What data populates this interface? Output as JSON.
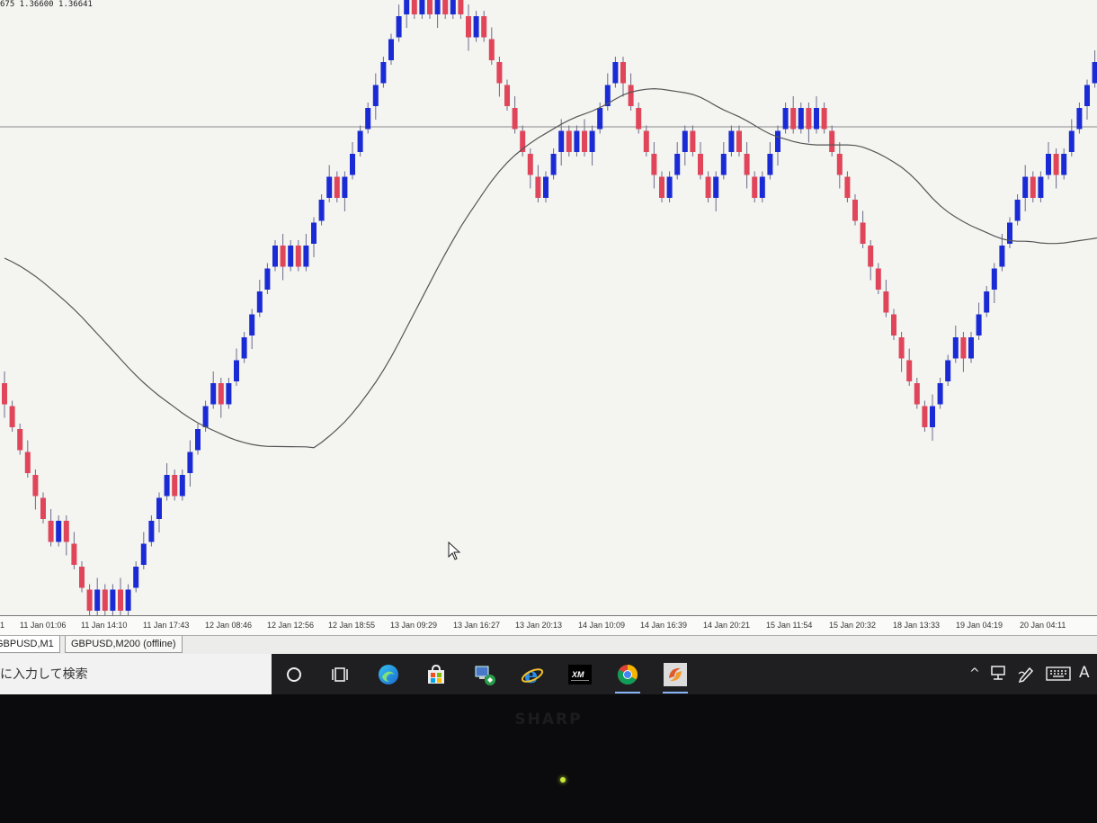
{
  "chart": {
    "ohlc_readout": "675 1.36600 1.36641",
    "colors": {
      "up": "#1a2bd6",
      "down": "#e0455a",
      "wick": "#6b6b8a",
      "moving_average": "#555555",
      "hline": "#8a8a8a",
      "background": "#f4f4f1"
    },
    "time_labels": [
      "1",
      "11 Jan 01:06",
      "11 Jan 14:10",
      "11 Jan 17:43",
      "12 Jan 08:46",
      "12 Jan 12:56",
      "12 Jan 18:55",
      "13 Jan 09:29",
      "13 Jan 16:27",
      "13 Jan 20:13",
      "14 Jan 10:09",
      "14 Jan 16:39",
      "14 Jan 20:21",
      "15 Jan 11:54",
      "15 Jan 20:32",
      "18 Jan 13:33",
      "19 Jan 04:19",
      "20 Jan 04:11"
    ]
  },
  "chart_data": {
    "type": "renko",
    "symbol": "GBPUSD",
    "bricks": [
      "d",
      "d",
      "d",
      "d",
      "d",
      "d",
      "d",
      "u",
      "d",
      "d",
      "d",
      "d",
      "u",
      "d",
      "u",
      "d",
      "u",
      "u",
      "u",
      "u",
      "u",
      "u",
      "d",
      "u",
      "u",
      "u",
      "u",
      "u",
      "d",
      "u",
      "u",
      "u",
      "u",
      "u",
      "u",
      "u",
      "d",
      "u",
      "d",
      "u",
      "u",
      "u",
      "u",
      "d",
      "u",
      "u",
      "u",
      "u",
      "u",
      "u",
      "u",
      "u",
      "u",
      "d",
      "u",
      "d",
      "u",
      "d",
      "u",
      "d",
      "d",
      "u",
      "d",
      "d",
      "d",
      "d",
      "d",
      "d",
      "d",
      "d",
      "u",
      "u",
      "u",
      "d",
      "u",
      "d",
      "u",
      "u",
      "u",
      "u",
      "d",
      "d",
      "d",
      "d",
      "d",
      "d",
      "u",
      "u",
      "u",
      "d",
      "d",
      "d",
      "u",
      "u",
      "u",
      "d",
      "d",
      "d",
      "u",
      "u",
      "u",
      "u",
      "d",
      "u",
      "d",
      "u",
      "d",
      "d",
      "d",
      "d",
      "d",
      "d",
      "d",
      "d",
      "d",
      "d",
      "d",
      "d",
      "d",
      "d",
      "u",
      "u",
      "u",
      "u",
      "d",
      "u",
      "u",
      "u",
      "u",
      "u",
      "u",
      "u",
      "u",
      "d",
      "u",
      "u",
      "d",
      "u",
      "u",
      "u",
      "u",
      "u",
      "u",
      "u"
    ]
  },
  "tabs": [
    {
      "label": "GBPUSD,M1"
    },
    {
      "label": "GBPUSD,M200 (offline)"
    }
  ],
  "taskbar": {
    "search_text": "に入力して検索",
    "icons": [
      "cortana-icon",
      "task-view-icon",
      "edge-icon",
      "store-icon",
      "network-app-icon",
      "internet-explorer-icon",
      "xm-icon",
      "chrome-icon",
      "app-icon"
    ],
    "tray": {
      "chevron": "^",
      "ime": "A"
    }
  },
  "monitor": {
    "brand": "SHARP"
  }
}
